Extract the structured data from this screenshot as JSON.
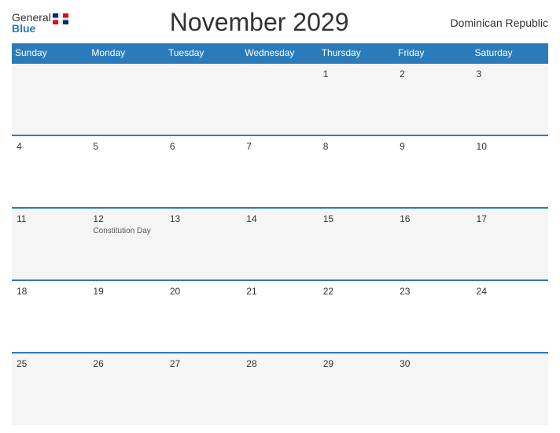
{
  "header": {
    "logo_general": "General",
    "logo_blue": "Blue",
    "title": "November 2029",
    "country": "Dominican Republic"
  },
  "days_of_week": [
    "Sunday",
    "Monday",
    "Tuesday",
    "Wednesday",
    "Thursday",
    "Friday",
    "Saturday"
  ],
  "weeks": [
    [
      {
        "date": "",
        "holiday": ""
      },
      {
        "date": "",
        "holiday": ""
      },
      {
        "date": "",
        "holiday": ""
      },
      {
        "date": "",
        "holiday": ""
      },
      {
        "date": "1",
        "holiday": ""
      },
      {
        "date": "2",
        "holiday": ""
      },
      {
        "date": "3",
        "holiday": ""
      }
    ],
    [
      {
        "date": "4",
        "holiday": ""
      },
      {
        "date": "5",
        "holiday": ""
      },
      {
        "date": "6",
        "holiday": ""
      },
      {
        "date": "7",
        "holiday": ""
      },
      {
        "date": "8",
        "holiday": ""
      },
      {
        "date": "9",
        "holiday": ""
      },
      {
        "date": "10",
        "holiday": ""
      }
    ],
    [
      {
        "date": "11",
        "holiday": ""
      },
      {
        "date": "12",
        "holiday": "Constitution Day"
      },
      {
        "date": "13",
        "holiday": ""
      },
      {
        "date": "14",
        "holiday": ""
      },
      {
        "date": "15",
        "holiday": ""
      },
      {
        "date": "16",
        "holiday": ""
      },
      {
        "date": "17",
        "holiday": ""
      }
    ],
    [
      {
        "date": "18",
        "holiday": ""
      },
      {
        "date": "19",
        "holiday": ""
      },
      {
        "date": "20",
        "holiday": ""
      },
      {
        "date": "21",
        "holiday": ""
      },
      {
        "date": "22",
        "holiday": ""
      },
      {
        "date": "23",
        "holiday": ""
      },
      {
        "date": "24",
        "holiday": ""
      }
    ],
    [
      {
        "date": "25",
        "holiday": ""
      },
      {
        "date": "26",
        "holiday": ""
      },
      {
        "date": "27",
        "holiday": ""
      },
      {
        "date": "28",
        "holiday": ""
      },
      {
        "date": "29",
        "holiday": ""
      },
      {
        "date": "30",
        "holiday": ""
      },
      {
        "date": "",
        "holiday": ""
      }
    ]
  ]
}
